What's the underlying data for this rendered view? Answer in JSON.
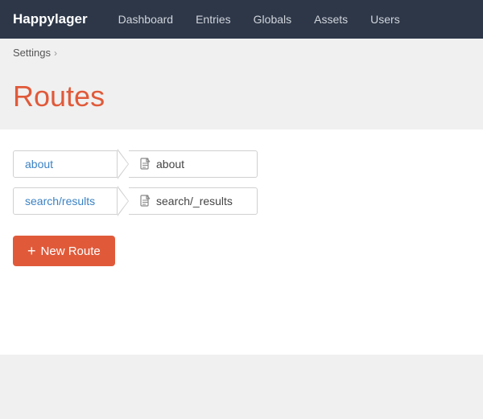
{
  "brand": "Happylager",
  "nav": {
    "links": [
      {
        "label": "Dashboard",
        "id": "dashboard"
      },
      {
        "label": "Entries",
        "id": "entries"
      },
      {
        "label": "Globals",
        "id": "globals"
      },
      {
        "label": "Assets",
        "id": "assets"
      },
      {
        "label": "Users",
        "id": "users"
      }
    ]
  },
  "breadcrumb": {
    "items": [
      "Settings"
    ],
    "separator": "›"
  },
  "page_title": "Routes",
  "routes": [
    {
      "slug": "about",
      "template": "about"
    },
    {
      "slug": "search/results",
      "template": "search/_results"
    }
  ],
  "new_route_button": {
    "plus": "+",
    "label": "New Route"
  },
  "colors": {
    "nav_bg": "#2d3748",
    "title_color": "#e05a3a",
    "slug_color": "#3b82c4",
    "button_bg": "#e05a3a"
  }
}
